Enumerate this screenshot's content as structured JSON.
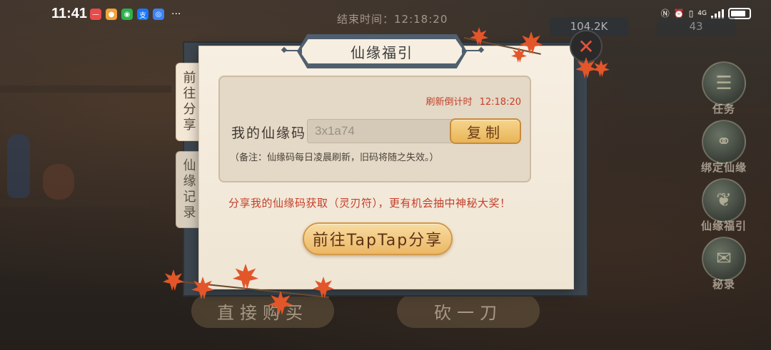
{
  "status_bar": {
    "time": "11:41",
    "more": "···",
    "network": "4G"
  },
  "hud": {
    "end_time": "结束时间：12:18:20",
    "currency_a": "104.2K",
    "currency_b": "43"
  },
  "background": {
    "buy_button": "直接购买",
    "slash_button": "砍一刀"
  },
  "sidebar": {
    "items": [
      {
        "label": "任务",
        "icon": "scroll-icon"
      },
      {
        "label": "绑定仙缘",
        "icon": "bind-icon"
      },
      {
        "label": "仙缘福引",
        "icon": "fortune-icon"
      },
      {
        "label": "秘录",
        "icon": "book-icon"
      }
    ]
  },
  "dialog": {
    "title": "仙缘福引",
    "close": "✕",
    "tabs": [
      {
        "label": "前往分享",
        "active": true
      },
      {
        "label": "仙缘记录",
        "active": false
      }
    ],
    "countdown_label": "刷新倒计时",
    "countdown_value": "12:18:20",
    "code_label": "我的仙缘码",
    "code_value": "3x1a74",
    "copy_button": "复制",
    "note": "（备注：仙缘码每日凌晨刷新，旧码将随之失效。）",
    "share_text": "分享我的仙缘码获取（灵刃符），更有机会抽中神秘大奖！",
    "share_button": "前往TapTap分享"
  },
  "colors": {
    "accent_red": "#c4402b",
    "button_gold": "#ebb766",
    "frame_blue": "#4f5f6e"
  }
}
